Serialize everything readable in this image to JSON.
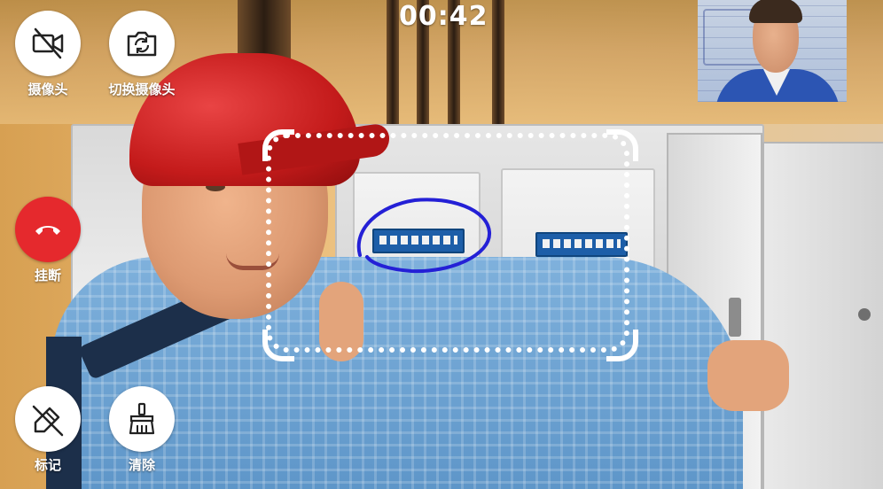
{
  "call": {
    "timer": "00:42"
  },
  "controls": {
    "camera_label": "摄像头",
    "switch_camera_label": "切换摄像头",
    "hangup_label": "挂断",
    "mark_label": "标记",
    "clear_label": "清除"
  },
  "colors": {
    "hangup": "#e5292d",
    "button_bg": "#ffffff",
    "annotation_stroke": "#2420d6",
    "focus_frame": "#ffffff"
  },
  "icons": {
    "camera": "camera-off-icon",
    "switch_camera": "camera-switch-icon",
    "hangup": "phone-hangup-icon",
    "mark": "pencil-off-icon",
    "clear": "broom-icon"
  }
}
